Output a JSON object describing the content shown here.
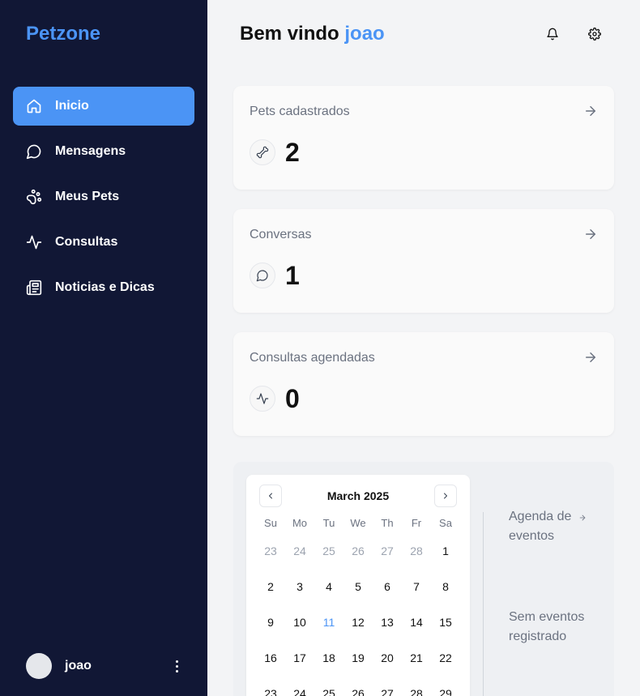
{
  "brand": "Petzone",
  "sidebar": {
    "items": [
      {
        "label": "Inicio",
        "icon": "home-icon",
        "active": true
      },
      {
        "label": "Mensagens",
        "icon": "message-icon",
        "active": false
      },
      {
        "label": "Meus Pets",
        "icon": "paw-icon",
        "active": false
      },
      {
        "label": "Consultas",
        "icon": "activity-icon",
        "active": false
      },
      {
        "label": "Noticias e Dicas",
        "icon": "newspaper-icon",
        "active": false
      }
    ],
    "user": {
      "name": "joao"
    }
  },
  "header": {
    "greeting": "Bem vindo",
    "username": "joao",
    "icons": [
      "bell-icon",
      "gear-icon"
    ]
  },
  "cards": [
    {
      "title": "Pets cadastrados",
      "value": "2",
      "icon": "bone-icon"
    },
    {
      "title": "Conversas",
      "value": "1",
      "icon": "message-icon"
    },
    {
      "title": "Consultas agendadas",
      "value": "0",
      "icon": "activity-icon"
    }
  ],
  "calendar": {
    "month": "March 2025",
    "weekdays": [
      "Su",
      "Mo",
      "Tu",
      "We",
      "Th",
      "Fr",
      "Sa"
    ],
    "weeks": [
      [
        {
          "d": "23",
          "m": true
        },
        {
          "d": "24",
          "m": true
        },
        {
          "d": "25",
          "m": true
        },
        {
          "d": "26",
          "m": true
        },
        {
          "d": "27",
          "m": true
        },
        {
          "d": "28",
          "m": true
        },
        {
          "d": "1",
          "m": false
        }
      ],
      [
        {
          "d": "2"
        },
        {
          "d": "3"
        },
        {
          "d": "4"
        },
        {
          "d": "5"
        },
        {
          "d": "6"
        },
        {
          "d": "7"
        },
        {
          "d": "8"
        }
      ],
      [
        {
          "d": "9"
        },
        {
          "d": "10"
        },
        {
          "d": "11",
          "today": true
        },
        {
          "d": "12"
        },
        {
          "d": "13"
        },
        {
          "d": "14"
        },
        {
          "d": "15"
        }
      ],
      [
        {
          "d": "16"
        },
        {
          "d": "17"
        },
        {
          "d": "18"
        },
        {
          "d": "19"
        },
        {
          "d": "20"
        },
        {
          "d": "21"
        },
        {
          "d": "22"
        }
      ],
      [
        {
          "d": "23"
        },
        {
          "d": "24"
        },
        {
          "d": "25"
        },
        {
          "d": "26"
        },
        {
          "d": "27"
        },
        {
          "d": "28"
        },
        {
          "d": "29"
        }
      ]
    ]
  },
  "events": {
    "link_label": "Agenda de eventos",
    "empty_label": "Sem eventos registrado"
  },
  "colors": {
    "accent": "#4b94f5",
    "sidebar_bg": "#111735",
    "page_bg": "#f3f4f6"
  }
}
